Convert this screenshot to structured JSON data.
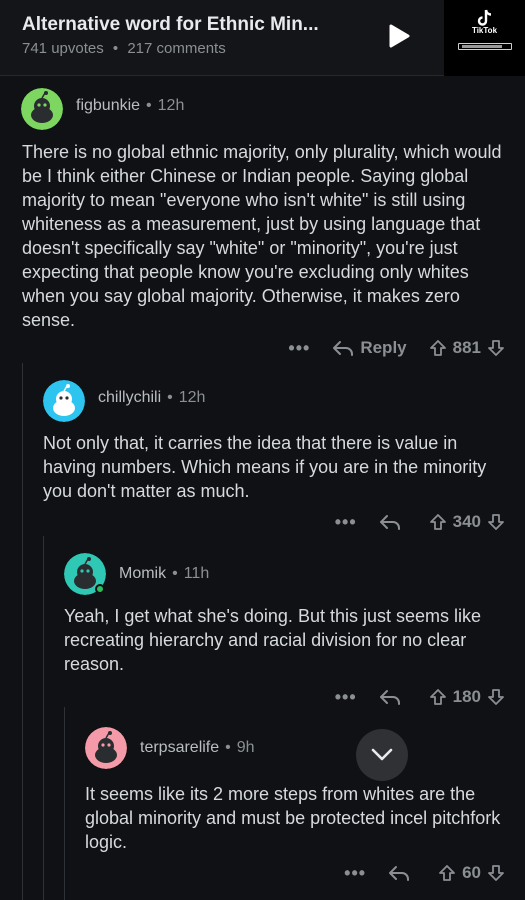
{
  "post": {
    "title": "Alternative word for Ethnic Min...",
    "upvotes": "741 upvotes",
    "separator": "•",
    "comments": "217 comments"
  },
  "watermark": {
    "brand": "TikTok"
  },
  "comments": [
    {
      "username": "figbunkie",
      "time": "12h",
      "avatar_color": "#7dd65f",
      "body": "There is no global ethnic majority, only plurality, which would be I think either Chinese or Indian people. Saying global majority to mean \"everyone who isn't white\" is still using whiteness as a measurement, just by using language that doesn't specifically say \"white\" or \"minority\", you're just expecting that people know you're excluding only whites when you say global majority. Otherwise, it makes zero sense.",
      "reply_label": "Reply",
      "score": "881"
    },
    {
      "username": "chillychili",
      "time": "12h",
      "avatar_color": "#2ec4f0",
      "body": "Not only that, it carries the idea that there is value in having numbers. Which means if you are in the minority you don't matter as much.",
      "score": "340"
    },
    {
      "username": "Momik",
      "time": "11h",
      "avatar_color": "#2ec8b4",
      "online": true,
      "body": "Yeah, I get what she's doing. But this just seems like recreating hierarchy and racial division for no clear reason.",
      "score": "180"
    },
    {
      "username": "terpsarelife",
      "time": "9h",
      "avatar_color": "#f49aa8",
      "body": "It seems like its 2 more steps from whites are the global minority and must be protected incel pitchfork logic.",
      "score": "60"
    }
  ],
  "ui": {
    "more_label": "•••",
    "dot": "•",
    "colors": {
      "background": "#0f1114",
      "text": "#d7dadc",
      "muted": "#8b8f93",
      "thread_line": "#2e3135"
    }
  }
}
